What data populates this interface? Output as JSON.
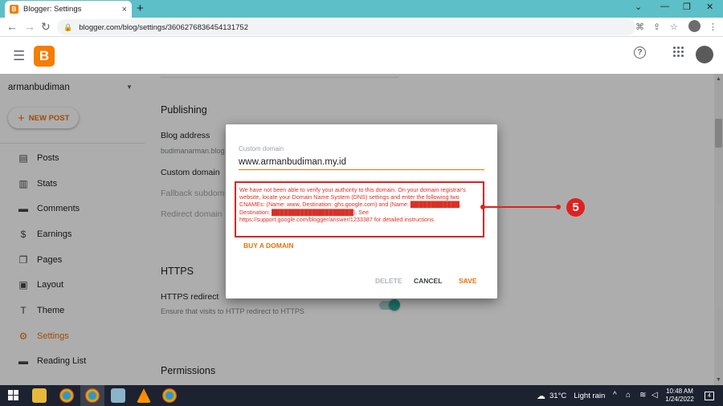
{
  "browser": {
    "tab_title": "Blogger: Settings",
    "tab_favicon": "B",
    "tab_close": "×",
    "new_tab": "+",
    "url": "blogger.com/blog/settings/3606276836454131752",
    "win_min": "⌄",
    "win_minimize": "—",
    "win_restore": "❐",
    "win_close": "✕"
  },
  "header": {
    "logo_letter": "B",
    "help": "?"
  },
  "sidebar": {
    "blog_name": "armanbudiman",
    "new_post_label": "NEW POST",
    "items": [
      {
        "label": "Posts",
        "icon": "▤"
      },
      {
        "label": "Stats",
        "icon": "▥"
      },
      {
        "label": "Comments",
        "icon": "▬"
      },
      {
        "label": "Earnings",
        "icon": "$"
      },
      {
        "label": "Pages",
        "icon": "❐"
      },
      {
        "label": "Layout",
        "icon": "▣"
      },
      {
        "label": "Theme",
        "icon": "T"
      },
      {
        "label": "Settings",
        "icon": "⚙"
      },
      {
        "label": "Reading List",
        "icon": "▬"
      }
    ]
  },
  "settings": {
    "publishing_title": "Publishing",
    "blog_address_label": "Blog address",
    "blog_address_value": "budimanarman.blog",
    "custom_domain_label": "Custom domain",
    "fallback_label": "Fallback subdom",
    "redirect_label": "Redirect domain",
    "https_title": "HTTPS",
    "https_redirect_label": "HTTPS redirect",
    "https_redirect_desc": "Ensure that visits to HTTP redirect to HTTPS",
    "permissions_title": "Permissions"
  },
  "dialog": {
    "field_label": "Custom domain",
    "field_value": "www.armanbudiman.my.id",
    "error_text": "We have not been able to verify your authority to this domain. On your domain registrar's website, locate your Domain Name System (DNS) settings and enter the following two CNAMEs: (Name: www, Destination: ghs.google.com) and (Name: ████████████, Destination: ████████████████████). See https://support.google.com/blogger/answer/1233387 for detailed instructions.",
    "buy_domain": "BUY A DOMAIN",
    "delete": "DELETE",
    "cancel": "CANCEL",
    "save": "SAVE"
  },
  "annotation": {
    "number": "5"
  },
  "taskbar": {
    "temperature": "31°C",
    "weather": "Light rain",
    "time": "10:48 AM",
    "date": "1/24/2022",
    "notifications": "4"
  },
  "colors": {
    "accent": "#e8710a",
    "error": "#d93025",
    "annotation": "#e02020",
    "tab_bar": "#5dbfc7"
  }
}
